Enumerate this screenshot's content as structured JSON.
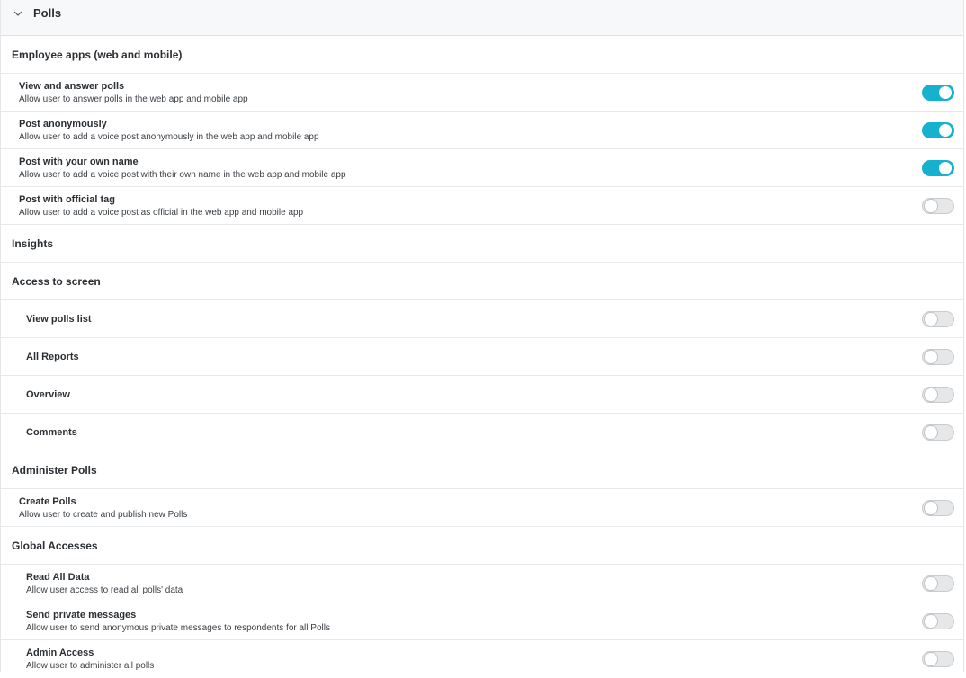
{
  "section": {
    "title": "Polls"
  },
  "groups": {
    "employee_apps": "Employee apps (web and mobile)",
    "insights": "Insights",
    "access_to_screen": "Access to screen",
    "administer_polls": "Administer Polls",
    "global_accesses": "Global Accesses"
  },
  "items": {
    "view_answer": {
      "title": "View and answer polls",
      "desc": "Allow user to answer polls in the web app and mobile app",
      "enabled": true
    },
    "post_anon": {
      "title": "Post anonymously",
      "desc": "Allow user to add a voice post anonymously in the web app and mobile app",
      "enabled": true
    },
    "post_own": {
      "title": "Post with your own name",
      "desc": "Allow user to add a voice post with their own name in the web app and mobile app",
      "enabled": true
    },
    "post_official": {
      "title": "Post with official tag",
      "desc": "Allow user to add a voice post as official in the web app and mobile app",
      "enabled": false
    },
    "view_polls_list": {
      "title": "View polls list",
      "enabled": false
    },
    "all_reports": {
      "title": "All Reports",
      "enabled": false
    },
    "overview": {
      "title": "Overview",
      "enabled": false
    },
    "comments": {
      "title": "Comments",
      "enabled": false
    },
    "create_polls": {
      "title": "Create Polls",
      "desc": "Allow user to create and publish new Polls",
      "enabled": false
    },
    "read_all": {
      "title": "Read All Data",
      "desc": "Allow user access to read all polls' data",
      "enabled": false
    },
    "send_private": {
      "title": "Send private messages",
      "desc": "Allow user to send anonymous private messages to respondents for all Polls",
      "enabled": false
    },
    "admin_access": {
      "title": "Admin Access",
      "desc": "Allow user to administer all polls",
      "enabled": false
    }
  },
  "colors": {
    "toggle_on": "#16b1cf",
    "toggle_off": "#e6e7e9"
  }
}
